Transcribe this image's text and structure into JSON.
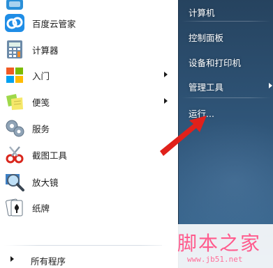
{
  "left_menu": {
    "items": [
      {
        "label": "",
        "icon": "partial-app-icon"
      },
      {
        "label": "百度云管家",
        "icon": "baidu-cloud-icon"
      },
      {
        "label": "计算器",
        "icon": "calculator-icon"
      },
      {
        "label": "入门",
        "icon": "getting-started-icon",
        "submenu": true
      },
      {
        "label": "便笺",
        "icon": "sticky-notes-icon",
        "submenu": true
      },
      {
        "label": "服务",
        "icon": "services-gear-icon"
      },
      {
        "label": "截图工具",
        "icon": "snipping-tool-icon"
      },
      {
        "label": "放大镜",
        "icon": "magnifier-icon"
      },
      {
        "label": "纸牌",
        "icon": "solitaire-icon"
      }
    ],
    "all_programs": "所有程序"
  },
  "right_menu": {
    "items": [
      {
        "label": "计算机"
      },
      {
        "label": "控制面板"
      },
      {
        "label": "设备和打印机"
      },
      {
        "label": "管理工具",
        "submenu": true
      },
      {
        "label": "运行..."
      }
    ]
  },
  "annotation": {
    "icon": "red-arrow-icon",
    "color": "#e0211b"
  },
  "watermark": {
    "text": "脚本之家",
    "url": "www.jb51.net",
    "color": "#ff5b8d"
  },
  "colors": {
    "right_pane": "#2c4f70",
    "left_pane": "#ffffff"
  }
}
